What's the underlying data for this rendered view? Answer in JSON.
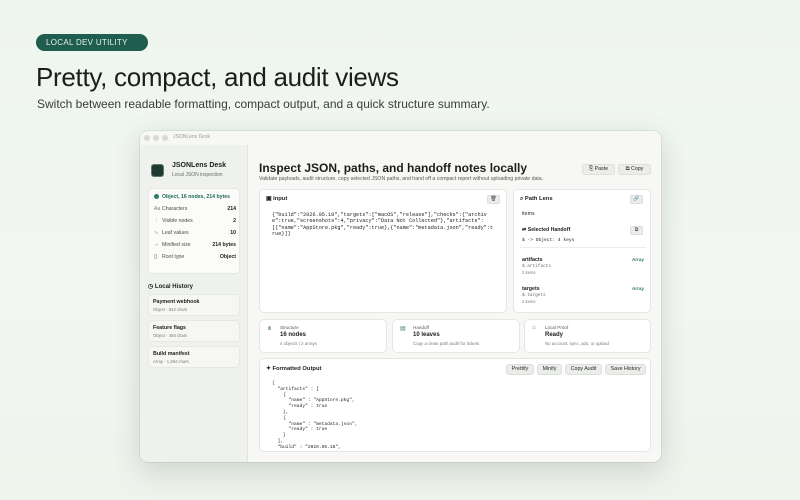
{
  "hero": {
    "badge": "LOCAL DEV UTILITY",
    "title": "Pretty, compact, and audit views",
    "subtitle": "Switch between readable formatting, compact output, and a quick structure summary."
  },
  "window": {
    "title": "JSONLens Desk"
  },
  "app": {
    "name": "JSONLens Desk",
    "subtitle": "Local JSON inspection"
  },
  "stats": {
    "header": "Object, 16 nodes, 214 bytes",
    "rows": [
      {
        "icon": "characters-icon",
        "glyph": "Aa",
        "label": "Characters",
        "value": "214"
      },
      {
        "icon": "nodes-icon",
        "glyph": "⋮",
        "label": "Visible nodes",
        "value": "2"
      },
      {
        "icon": "leaf-icon",
        "glyph": "∿",
        "label": "Leaf values",
        "value": "10"
      },
      {
        "icon": "minified-icon",
        "glyph": "⇔",
        "label": "Minified size",
        "value": "214 bytes"
      },
      {
        "icon": "braces-icon",
        "glyph": "{}",
        "label": "Root type",
        "value": "Object"
      }
    ]
  },
  "history": {
    "title": "Local History",
    "items": [
      {
        "title": "Payment webhook",
        "meta": "Object · 842 chars"
      },
      {
        "title": "Feature flags",
        "meta": "Object · 458 chars"
      },
      {
        "title": "Build manifest",
        "meta": "Array · 1,284 chars"
      }
    ]
  },
  "main": {
    "title": "Inspect JSON, paths, and handoff notes locally",
    "subtitle": "Validate payloads, audit structure, copy selected JSON paths, and hand off a compact report without uploading private data.",
    "paste_label": "Paste",
    "copy_label": "Copy"
  },
  "input": {
    "title": "Input",
    "value": "{\"build\":\"2026.05.18\",\"targets\":[\"macOS\",\"release\"],\"checks\":{\"archive\":true,\"screenshots\":4,\"privacy\":\"Data Not Collected\"},\"artifacts\":[{\"name\":\"AppStore.pkg\",\"ready\":true},{\"name\":\"metadata.json\",\"ready\":true}]}"
  },
  "path_lens": {
    "title": "Path Lens",
    "field_label": "items",
    "selected_title": "Selected Handoff",
    "selected_path": "$ -> Object: 4 keys",
    "rows": [
      {
        "key": "artifacts",
        "path": "$.artifacts",
        "count": "2 items",
        "type": "Array"
      },
      {
        "key": "targets",
        "path": "$.targets",
        "count": "2 items",
        "type": "Array"
      }
    ]
  },
  "summary": [
    {
      "icon": "structure-icon",
      "glyph": "⋔",
      "label": "Structure",
      "value": "16 nodes",
      "desc": "4 objects | 2 arrays"
    },
    {
      "icon": "handoff-icon",
      "glyph": "▤",
      "label": "Handoff",
      "value": "10 leaves",
      "desc": "Copy a clean path audit for tickets"
    },
    {
      "icon": "lock-icon",
      "glyph": "⌂",
      "label": "Local Proof",
      "value": "Ready",
      "desc": "No account, sync, ads, or upload"
    }
  ],
  "output": {
    "title": "Formatted Output",
    "buttons": [
      "Prettify",
      "Minify",
      "Copy Audit",
      "Save History"
    ],
    "text": "{\n  \"artifacts\" : [\n    {\n      \"name\" : \"AppStore.pkg\",\n      \"ready\" : true\n    },\n    {\n      \"name\" : \"metadata.json\",\n      \"ready\" : true\n    }\n  ],\n  \"build\" : \"2026.05.18\","
  }
}
